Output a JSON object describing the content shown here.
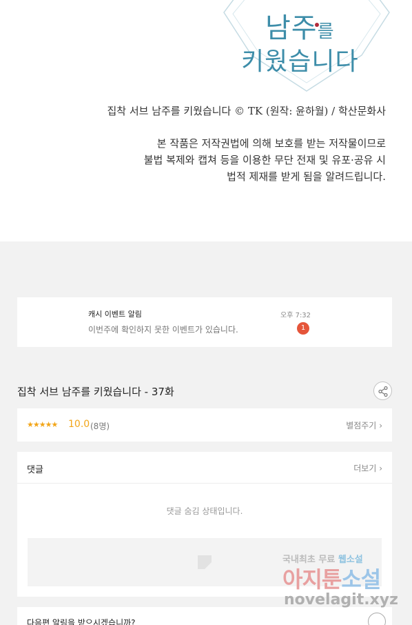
{
  "comic": {
    "logo_line1_a": "남주",
    "logo_line1_b": "를",
    "logo_line2": "키웠습니다",
    "credit": "집착 서브 남주를 키웠습니다 © TK (원작: 윤하월) / 학산문화사",
    "notice_line1": "본 작품은 저작권법에 의해 보호를 받는 저작물이므로",
    "notice_line2": "불법 복제와 캡쳐 등을 이용한 무단 전재 및 유포·공유 시",
    "notice_line3": "법적 제재를 받게 됨을 알려드립니다."
  },
  "notification": {
    "title": "캐시 이벤트 알림",
    "message": "이번주에 확인하지 못한 이벤트가 있습니다.",
    "time": "오후 7:32",
    "badge": "1"
  },
  "episode": {
    "title": "집착 서브 남주를 키웠습니다 - 37화"
  },
  "rating": {
    "stars": "★★★★★",
    "score": "10.0",
    "count": "(8명)",
    "rate_label": "별점주기",
    "value": 10.0,
    "max": 10
  },
  "comments": {
    "title": "댓글",
    "more_label": "더보기",
    "empty_text": "댓글 숨김 상태입니다."
  },
  "next_alarm": {
    "text": "다음편 알림을 받으시겠습니까?"
  },
  "watermark": {
    "line1_a": "국내최초 무료",
    "line1_b": "웹소설",
    "line2_a": "아지툰",
    "line2_b": "소설",
    "url": "novelagit.xyz"
  },
  "colors": {
    "accent": "#f2a518",
    "badge": "#e5553a",
    "logo": "#3d8da9",
    "background": "#f2f2f2"
  }
}
